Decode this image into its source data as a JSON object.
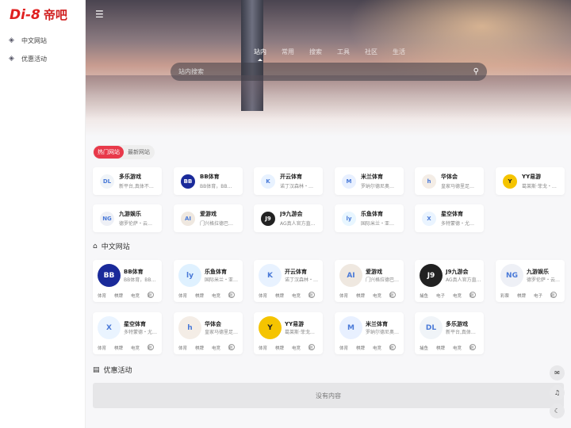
{
  "logo": {
    "mark": "Di-8",
    "cn": "帝吧"
  },
  "nav": [
    {
      "label": "中文网站"
    },
    {
      "label": "优惠活动"
    }
  ],
  "hero_tabs": [
    "站内",
    "常用",
    "搜索",
    "工具",
    "社区",
    "生活"
  ],
  "search": {
    "placeholder": "站内搜索"
  },
  "pills": [
    "热门网站",
    "最新网站"
  ],
  "hot": [
    {
      "name": "多乐游戏",
      "desc": "新平台,真体不…",
      "color": "#f0f4f8",
      "icon": "DL"
    },
    {
      "name": "BB体育",
      "desc": "BB体育，BB…",
      "color": "#1a2a9a",
      "icon": "BB"
    },
    {
      "name": "开云体育",
      "desc": "诺丁汉森林・…",
      "color": "#e8f2ff",
      "icon": "K"
    },
    {
      "name": "米兰体育",
      "desc": "罗纳尔德尼奥…",
      "color": "#e8f0ff",
      "icon": "M"
    },
    {
      "name": "华体会",
      "desc": "皇家马德里足…",
      "color": "#f4ede6",
      "icon": "h"
    },
    {
      "name": "YY易游",
      "desc": "葛莱斯·菲戈・…",
      "color": "#f5c400",
      "icon": "Y"
    },
    {
      "name": "九游娱乐",
      "desc": "德罗伦萨・云…",
      "color": "#eef0f6",
      "icon": "NG"
    },
    {
      "name": "爱游戏",
      "desc": "门兴格拉德巴…",
      "color": "#efe8e0",
      "icon": "AI"
    },
    {
      "name": "J9九游会",
      "desc": "AG真人官方直…",
      "color": "#222",
      "icon": "J9"
    },
    {
      "name": "乐鱼体育",
      "desc": "国际米兰・亚…",
      "color": "#e8f6ff",
      "icon": "ly"
    },
    {
      "name": "星空体育",
      "desc": "多特蒙德・尤…",
      "color": "#eaf4ff",
      "icon": "X"
    }
  ],
  "section_cn": {
    "title": "中文网站"
  },
  "section_promo": {
    "title": "优惠活动"
  },
  "sites": [
    {
      "name": "BB体育",
      "desc": "BB体育，BB…",
      "color": "#1a2a9a",
      "icon": "BB",
      "tags": [
        "体育",
        "棋牌",
        "电竞",
        "彩"
      ]
    },
    {
      "name": "乐鱼体育",
      "desc": "国际米兰・亚…",
      "color": "#dff1ff",
      "icon": "ly",
      "tags": [
        "体育",
        "棋牌",
        "电竞",
        "彩"
      ]
    },
    {
      "name": "开云体育",
      "desc": "诺丁汉森林・…",
      "color": "#e8f2ff",
      "icon": "K",
      "tags": [
        "体育",
        "棋牌",
        "电竞",
        "彩"
      ]
    },
    {
      "name": "爱游戏",
      "desc": "门兴格拉德巴…",
      "color": "#efe8e0",
      "icon": "AI",
      "tags": [
        "体育",
        "棋牌",
        "电竞",
        "彩"
      ]
    },
    {
      "name": "J9九游会",
      "desc": "AG真人官方直…",
      "color": "#222",
      "icon": "J9",
      "tags": [
        "捕鱼",
        "电子",
        "电竞",
        "彩"
      ]
    },
    {
      "name": "九游娱乐",
      "desc": "德罗伦萨・云…",
      "color": "#eef0f6",
      "icon": "NG",
      "tags": [
        "彩票",
        "棋牌",
        "电子",
        "彩"
      ]
    },
    {
      "name": "星空体育",
      "desc": "多特蒙德・尤…",
      "color": "#eaf4ff",
      "icon": "X",
      "tags": [
        "体育",
        "棋牌",
        "电竞",
        "彩"
      ]
    },
    {
      "name": "华体会",
      "desc": "皇家马德里足…",
      "color": "#f4ede6",
      "icon": "h",
      "tags": [
        "体育",
        "棋牌",
        "电竞",
        "彩"
      ]
    },
    {
      "name": "YY易游",
      "desc": "葛莱斯·菲戈…",
      "color": "#f5c400",
      "icon": "Y",
      "tags": [
        "体育",
        "棋牌",
        "电竞",
        "彩"
      ]
    },
    {
      "name": "米兰体育",
      "desc": "罗纳尔德尼奥…",
      "color": "#e8f0ff",
      "icon": "M",
      "tags": [
        "体育",
        "棋牌",
        "电竞",
        "彩"
      ]
    },
    {
      "name": "多乐游戏",
      "desc": "新平台,真体…",
      "color": "#f0f4f8",
      "icon": "DL",
      "tags": [
        "捕鱼",
        "棋牌",
        "电竞",
        "彩"
      ]
    }
  ],
  "empty_text": "没有内容",
  "colors": {
    "accent": "#e8394a"
  }
}
